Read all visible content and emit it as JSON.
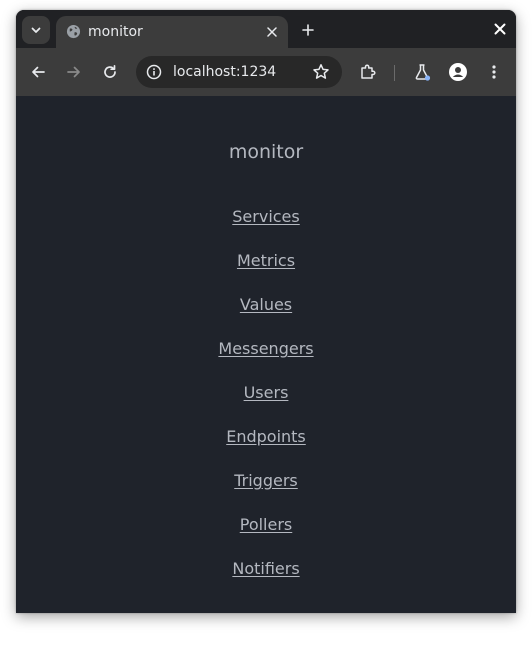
{
  "browser": {
    "tab": {
      "title": "monitor",
      "favicon": "globe-icon"
    },
    "address_bar": {
      "url": "localhost:1234"
    },
    "icons": {
      "tab_search": "chevron-down-icon",
      "tab_close": "close-icon",
      "new_tab": "plus-icon",
      "window_close": "close-icon",
      "back": "arrow-left-icon",
      "forward": "arrow-right-icon",
      "reload": "reload-icon",
      "site_info": "info-icon",
      "bookmark": "star-icon",
      "extensions": "puzzle-icon",
      "labs": "flask-icon",
      "profile": "person-icon",
      "menu": "kebab-menu-icon"
    }
  },
  "page": {
    "title": "monitor",
    "nav": [
      {
        "label": "Services"
      },
      {
        "label": "Metrics"
      },
      {
        "label": "Values"
      },
      {
        "label": "Messengers"
      },
      {
        "label": "Users"
      },
      {
        "label": "Endpoints"
      },
      {
        "label": "Triggers"
      },
      {
        "label": "Pollers"
      },
      {
        "label": "Notifiers"
      }
    ]
  },
  "colors": {
    "page_background": "#1f232b",
    "text": "#b4b8c0",
    "toolbar": "#3c3c3c",
    "tabstrip": "#202124"
  }
}
